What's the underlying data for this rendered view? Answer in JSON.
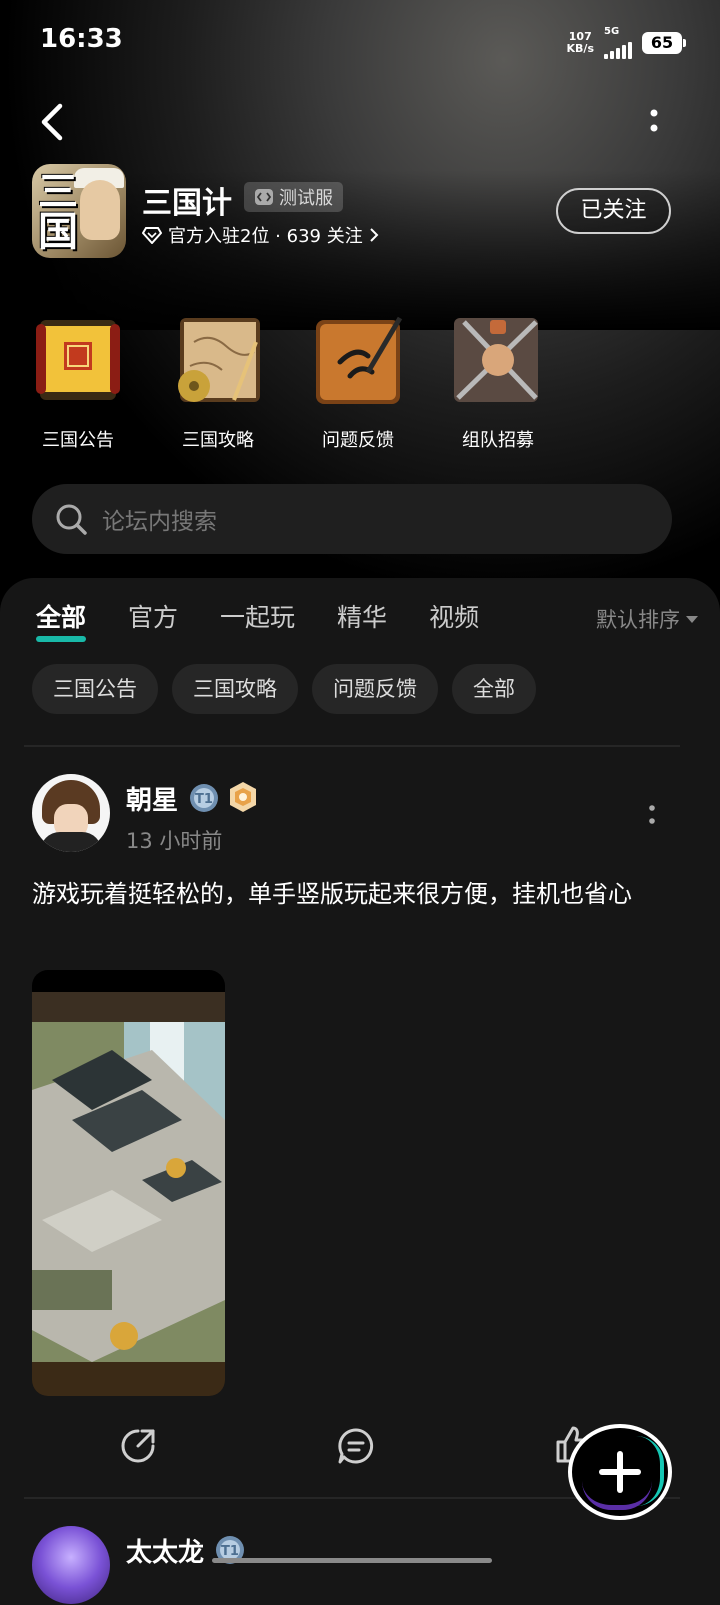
{
  "status_bar": {
    "time": "16:33",
    "speed_value": "107",
    "speed_unit": "KB/s",
    "network": "5G",
    "battery": "65"
  },
  "header": {
    "game_name": "三国计",
    "test_badge": "测试服",
    "meta": "官方入驻2位 · 639 关注",
    "follow_label": "已关注"
  },
  "shortcuts": [
    {
      "label": "三国公告",
      "icon": "scroll-seal-icon"
    },
    {
      "label": "三国攻略",
      "icon": "map-scroll-icon"
    },
    {
      "label": "问题反馈",
      "icon": "brush-board-icon"
    },
    {
      "label": "组队招募",
      "icon": "crossed-weapons-icon"
    }
  ],
  "search": {
    "placeholder": "论坛内搜索"
  },
  "tabs": [
    {
      "label": "全部",
      "active": true
    },
    {
      "label": "官方"
    },
    {
      "label": "一起玩"
    },
    {
      "label": "精华"
    },
    {
      "label": "视频"
    }
  ],
  "sort_label": "默认排序",
  "chips": [
    "三国公告",
    "三国攻略",
    "问题反馈",
    "全部"
  ],
  "posts": [
    {
      "author": "朝星",
      "time": "13 小时前",
      "text": "游戏玩着挺轻松的，单手竖版玩起来很方便，挂机也省心",
      "level_badge": "T1"
    },
    {
      "author": "太太龙",
      "level_badge": "T1"
    }
  ],
  "colors": {
    "accent": "#19b9a8",
    "background": "#161616",
    "chip": "#262626"
  }
}
